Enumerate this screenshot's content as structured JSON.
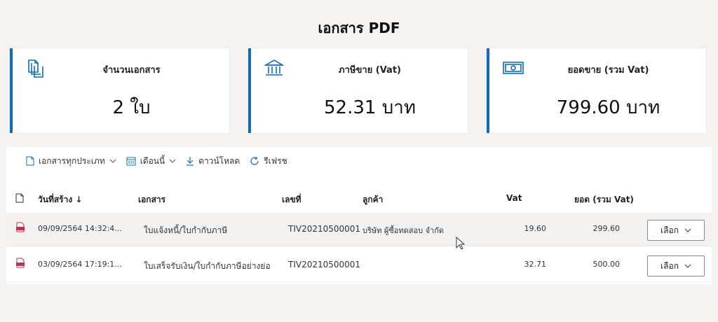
{
  "page": {
    "title": "เอกสาร PDF"
  },
  "cards": [
    {
      "label": "จำนวนเอกสาร",
      "value": "2 ใบ",
      "icon": "documents-icon"
    },
    {
      "label": "ภาษีขาย (Vat)",
      "value": "52.31 บาท",
      "icon": "bank-icon"
    },
    {
      "label": "ยอดขาย (รวม Vat)",
      "value": "799.60 บาท",
      "icon": "money-icon"
    }
  ],
  "toolbar": {
    "doc_type": "เอกสารทุกประเภท",
    "period": "เดือนนี้",
    "download": "ดาวน์โหลด",
    "refresh": "รีเฟรช"
  },
  "table": {
    "headers": {
      "created": "วันที่สร้าง ↓",
      "document": "เอกสาร",
      "number": "เลขที่",
      "customer": "ลูกค้า",
      "vat": "Vat",
      "total": "ยอด (รวม Vat)"
    },
    "rows": [
      {
        "created": "09/09/2564 14:32:4...",
        "document": "ใบแจ้งหนี้/ใบกำกับภาษี",
        "number": "TIV20210500001",
        "customer": "บริษัท ผู้ซื้อทดสอบ จำกัด",
        "vat": "19.60",
        "total": "299.60",
        "action": "เลือก"
      },
      {
        "created": "03/09/2564 17:19:1...",
        "document": "ใบเสร็จรับเงิน/ใบกำกับภาษีอย่างย่อ",
        "number": "TIV20210500001",
        "customer": "",
        "vat": "32.71",
        "total": "500.00",
        "action": "เลือก"
      }
    ]
  },
  "colors": {
    "accent": "#0f6cbd",
    "pdf": "#c4314b"
  }
}
